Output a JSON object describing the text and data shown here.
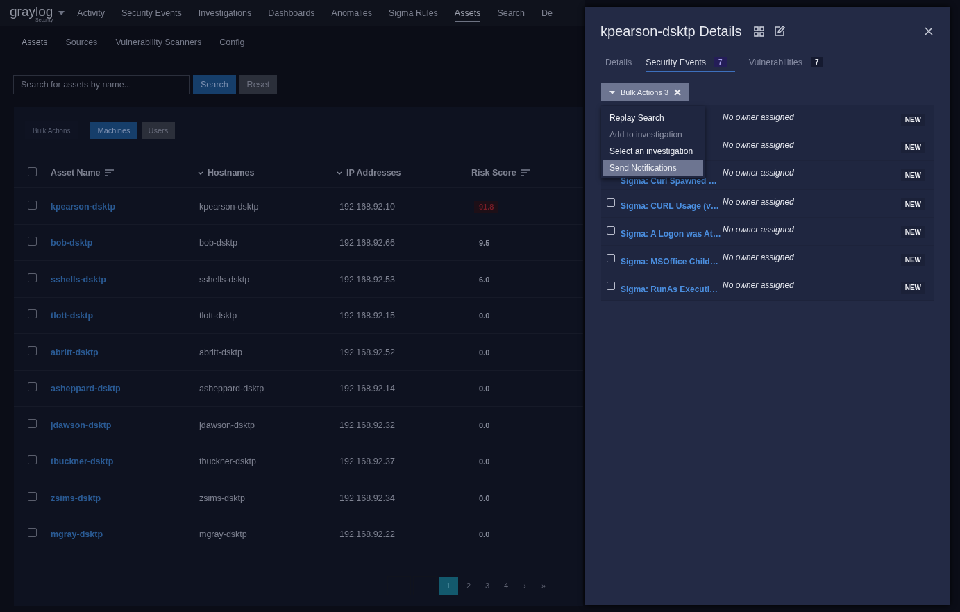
{
  "brand": {
    "name": "graylog",
    "sub": "Security"
  },
  "nav": [
    {
      "label": "Activity",
      "selected": false
    },
    {
      "label": "Security Events",
      "selected": false
    },
    {
      "label": "Investigations",
      "selected": false
    },
    {
      "label": "Dashboards",
      "selected": false
    },
    {
      "label": "Anomalies",
      "selected": false
    },
    {
      "label": "Sigma Rules",
      "selected": false
    },
    {
      "label": "Assets",
      "selected": true
    },
    {
      "label": "Search",
      "selected": false
    },
    {
      "label": "De",
      "selected": false
    }
  ],
  "subnav": [
    {
      "label": "Assets",
      "selected": true
    },
    {
      "label": "Sources",
      "selected": false
    },
    {
      "label": "Vulnerability Scanners",
      "selected": false
    },
    {
      "label": "Config",
      "selected": false
    }
  ],
  "search": {
    "placeholder": "Search for assets by name...",
    "button": "Search",
    "reset": "Reset"
  },
  "table": {
    "bulk_actions": "Bulk Actions",
    "filters": [
      {
        "label": "Machines",
        "selected": true
      },
      {
        "label": "Users",
        "selected": false
      }
    ],
    "select_all": {
      "checked": false
    },
    "columns": [
      {
        "label": "Asset Name",
        "kind": "sort"
      },
      {
        "label": "Hostnames",
        "kind": "expand"
      },
      {
        "label": "IP Addresses",
        "kind": "expand"
      },
      {
        "label": "Risk Score",
        "kind": "sort"
      }
    ],
    "rows": [
      {
        "name": "kpearson-dsktp",
        "host": "kpearson-dsktp",
        "ip": "192.168.92.10",
        "risk": "91.8",
        "high": true,
        "checked": false
      },
      {
        "name": "bob-dsktp",
        "host": "bob-dsktp",
        "ip": "192.168.92.66",
        "risk": "9.5",
        "high": false,
        "checked": false
      },
      {
        "name": "sshells-dsktp",
        "host": "sshells-dsktp",
        "ip": "192.168.92.53",
        "risk": "6.0",
        "high": false,
        "checked": false
      },
      {
        "name": "tlott-dsktp",
        "host": "tlott-dsktp",
        "ip": "192.168.92.15",
        "risk": "0.0",
        "high": false,
        "checked": false
      },
      {
        "name": "abritt-dsktp",
        "host": "abritt-dsktp",
        "ip": "192.168.92.52",
        "risk": "0.0",
        "high": false,
        "checked": false
      },
      {
        "name": "asheppard-dsktp",
        "host": "asheppard-dsktp",
        "ip": "192.168.92.14",
        "risk": "0.0",
        "high": false,
        "checked": false
      },
      {
        "name": "jdawson-dsktp",
        "host": "jdawson-dsktp",
        "ip": "192.168.92.32",
        "risk": "0.0",
        "high": false,
        "checked": false
      },
      {
        "name": "tbuckner-dsktp",
        "host": "tbuckner-dsktp",
        "ip": "192.168.92.37",
        "risk": "0.0",
        "high": false,
        "checked": false
      },
      {
        "name": "zsims-dsktp",
        "host": "zsims-dsktp",
        "ip": "192.168.92.34",
        "risk": "0.0",
        "high": false,
        "checked": false
      },
      {
        "name": "mgray-dsktp",
        "host": "mgray-dsktp",
        "ip": "192.168.92.22",
        "risk": "0.0",
        "high": false,
        "checked": false
      }
    ]
  },
  "pagination": [
    {
      "label": "1",
      "selected": true
    },
    {
      "label": "2",
      "selected": false
    },
    {
      "label": "3",
      "selected": false
    },
    {
      "label": "4",
      "selected": false
    },
    {
      "label": "›",
      "selected": false
    },
    {
      "label": "»",
      "selected": false
    }
  ],
  "drawer": {
    "title": "kpearson-dsktp Details",
    "tabs": [
      {
        "label": "Details",
        "selected": false
      },
      {
        "label": "Security Events",
        "count": "7",
        "selected": true
      },
      {
        "label": "Vulnerabilities",
        "count": "7",
        "selected": false
      }
    ],
    "bulk_actions": {
      "label": "Bulk Actions 3",
      "menu": [
        {
          "label": "Replay Search",
          "disabled": false,
          "selected": false
        },
        {
          "label": "Add to investigation",
          "disabled": true,
          "selected": false
        },
        {
          "label": "Select an investigation",
          "disabled": false,
          "selected": false
        },
        {
          "label": "Send Notifications",
          "disabled": false,
          "selected": true
        }
      ]
    },
    "events": [
      {
        "owner": "No owner assigned",
        "status": "NEW"
      },
      {
        "owner": "No owner assigned",
        "status": "NEW"
      },
      {
        "title": "Sigma: Curl Spawned …",
        "owner": "No owner assigned",
        "status": "NEW"
      },
      {
        "checked": false,
        "title": "Sigma: CURL Usage (v…",
        "owner": "No owner assigned",
        "status": "NEW"
      },
      {
        "checked": false,
        "title": "Sigma: A Logon was At…",
        "owner": "No owner assigned",
        "status": "NEW"
      },
      {
        "checked": false,
        "title": "Sigma: MSOffice Child…",
        "owner": "No owner assigned",
        "status": "NEW"
      },
      {
        "checked": false,
        "title": "Sigma: RunAs Executi…",
        "owner": "No owner assigned",
        "status": "NEW"
      }
    ]
  }
}
